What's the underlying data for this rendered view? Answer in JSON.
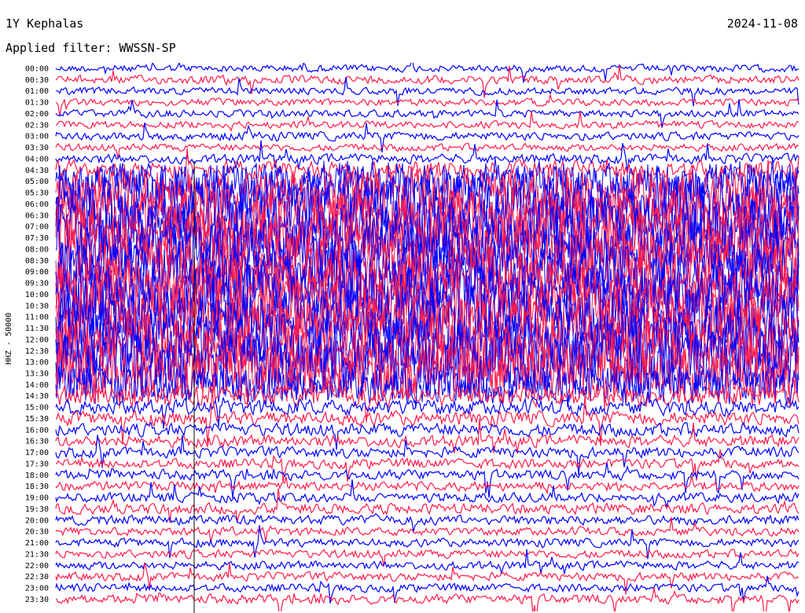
{
  "header": {
    "station": "1Y Kephalas",
    "date": "2024-11-08",
    "filter": "Applied filter: WWSSN-SP"
  },
  "chart_data": {
    "type": "line",
    "title": "1Y Kephalas",
    "subtitle": "Applied filter: WWSSN-SP",
    "ylabel": "HHZ - 50000",
    "xlabel": "",
    "colors": {
      "even_row": "#0000ff",
      "odd_row": "#ff1a4a",
      "cursor": "#000000"
    },
    "grid": false,
    "row_labels": [
      "00:00",
      "00:30",
      "01:00",
      "01:30",
      "02:00",
      "02:30",
      "03:00",
      "03:30",
      "04:00",
      "04:30",
      "05:00",
      "05:30",
      "06:00",
      "06:30",
      "07:00",
      "07:30",
      "08:00",
      "08:30",
      "09:00",
      "09:30",
      "10:00",
      "10:30",
      "11:00",
      "11:30",
      "12:00",
      "12:30",
      "13:00",
      "13:30",
      "14:00",
      "14:30",
      "15:00",
      "15:30",
      "16:00",
      "16:30",
      "17:00",
      "17:30",
      "18:00",
      "18:30",
      "19:00",
      "19:30",
      "20:00",
      "20:30",
      "21:00",
      "21:30",
      "22:00",
      "22:30",
      "23:00",
      "23:30"
    ],
    "series": [
      {
        "values": [
          0.1,
          0.12,
          0.1,
          0.1,
          0.1,
          0.1,
          0.12,
          0.1,
          0.14,
          0.3,
          0.6,
          0.8,
          1,
          1,
          1,
          1,
          1,
          1,
          1,
          1,
          1,
          1,
          1,
          1,
          1,
          1,
          1,
          1,
          0.6,
          0.35,
          0.25,
          0.22,
          0.2,
          0.18,
          0.16,
          0.15,
          0.15,
          0.14,
          0.14,
          0.16,
          0.14,
          0.12,
          0.12,
          0.12,
          0.12,
          0.12,
          0.12,
          0.14
        ]
      }
    ]
  }
}
